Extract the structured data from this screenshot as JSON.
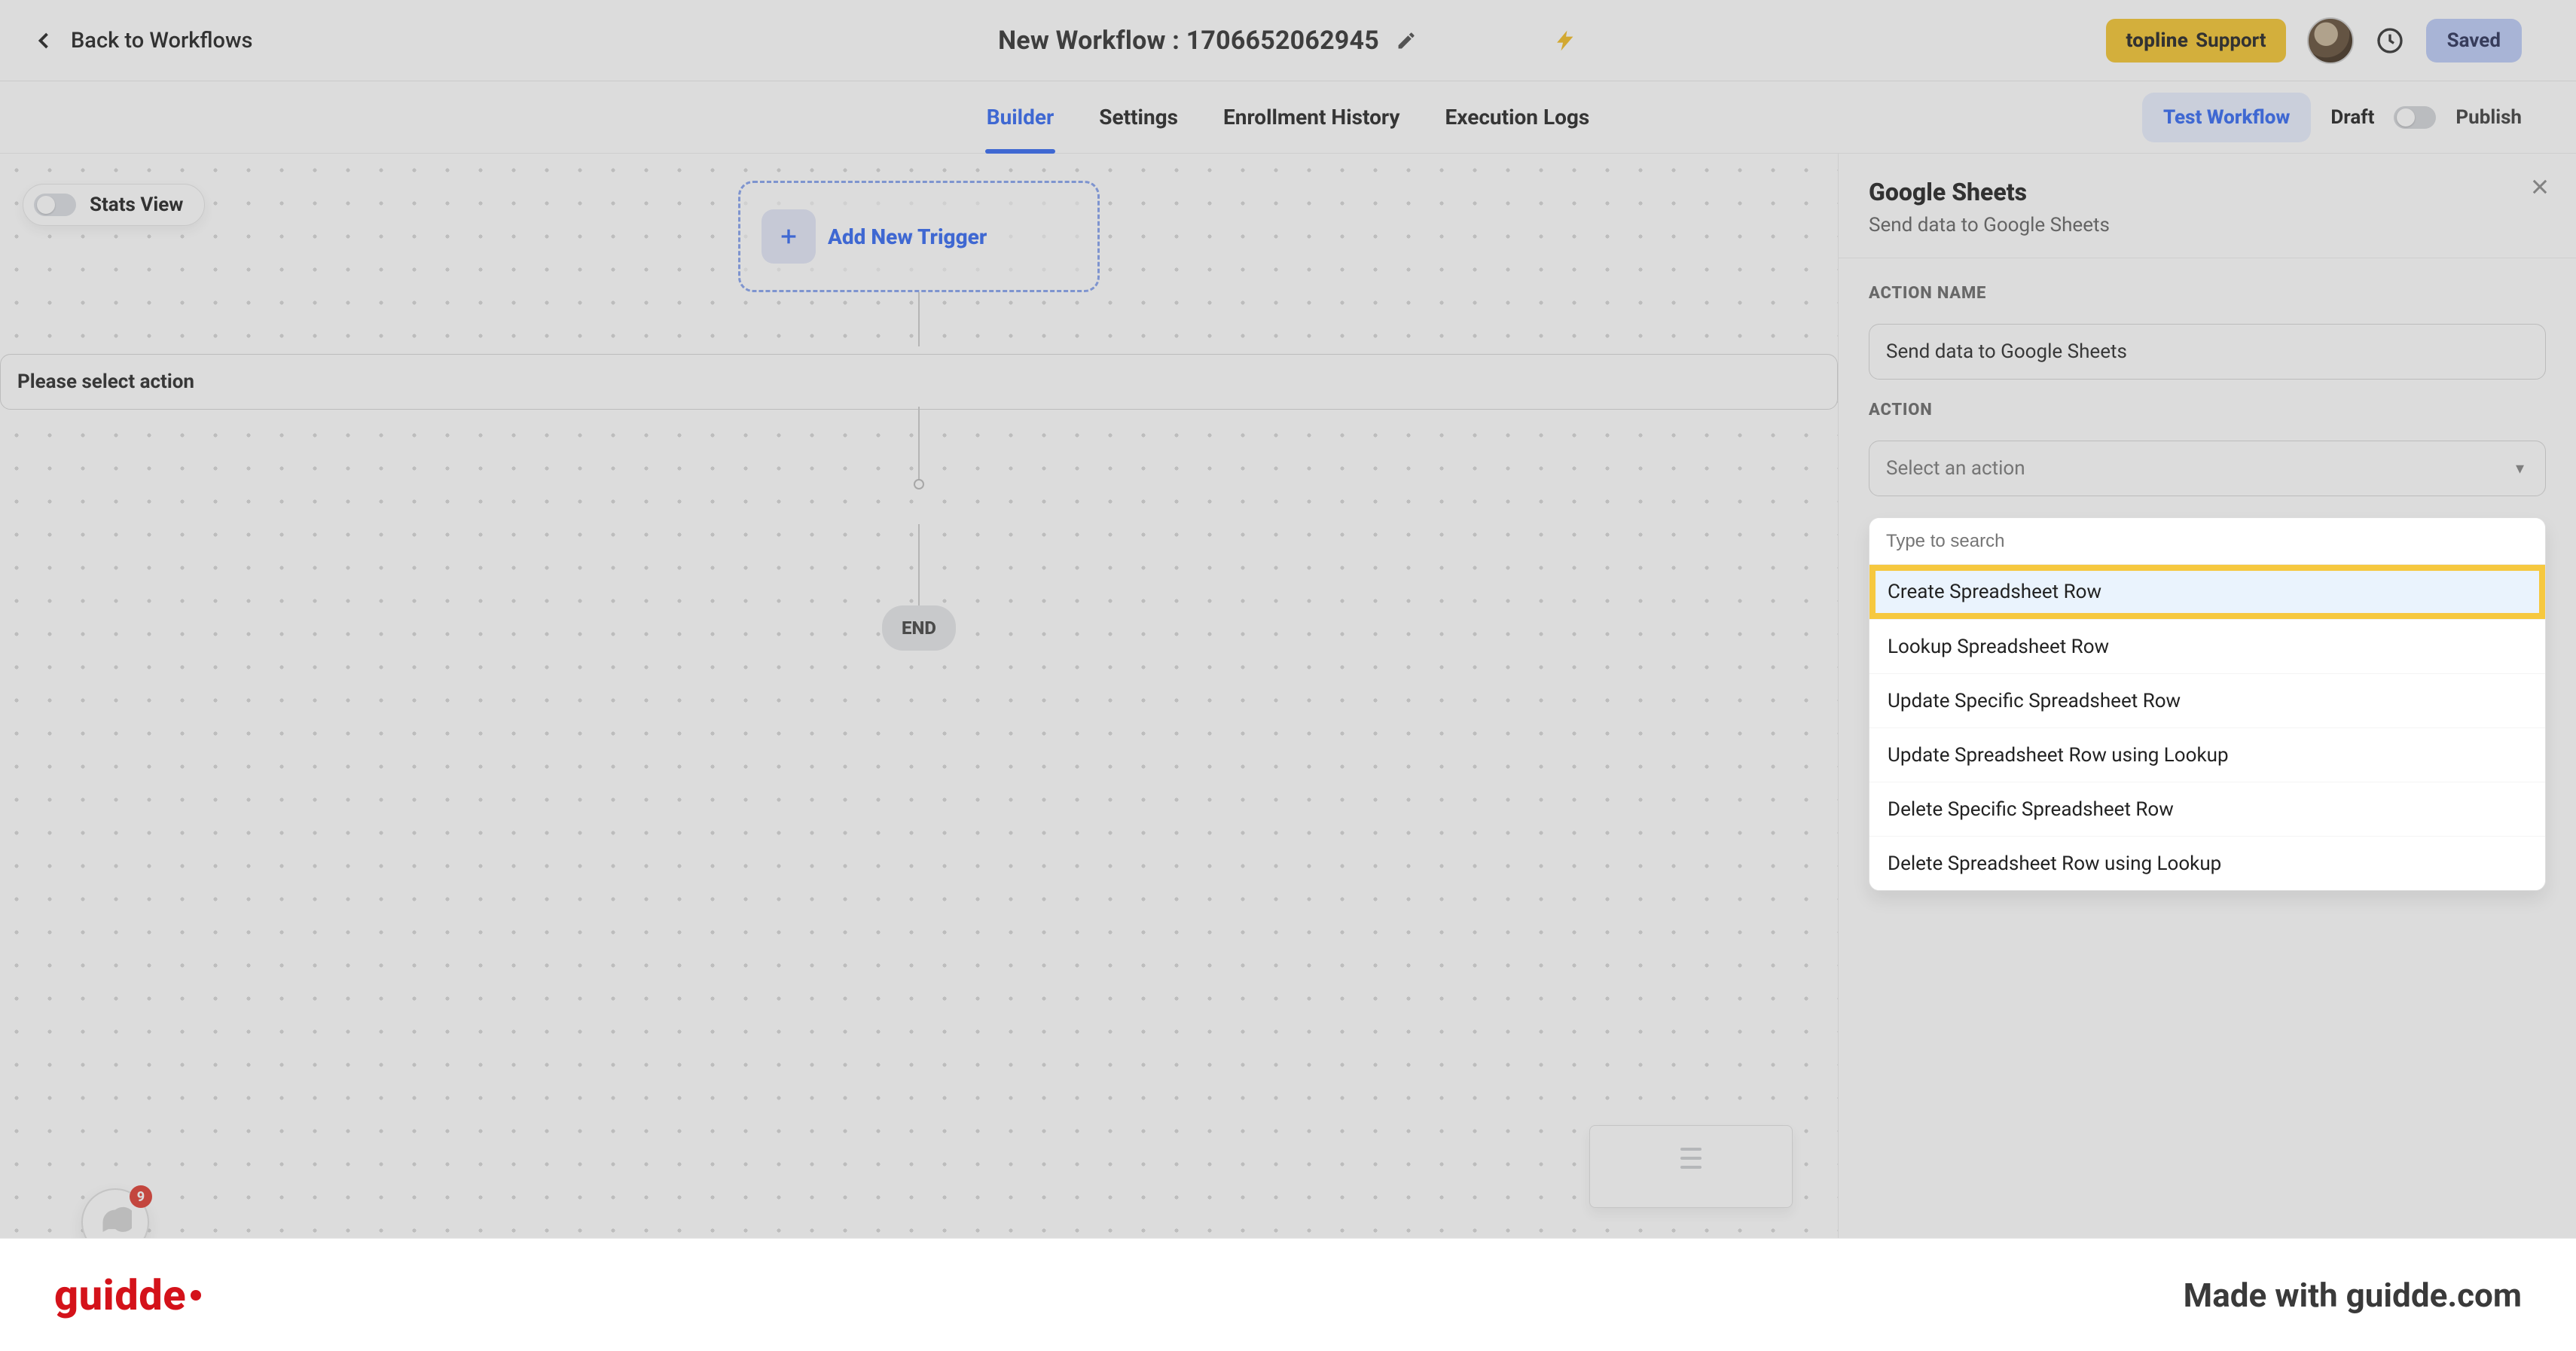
{
  "header": {
    "back_label": "Back to Workflows",
    "title": "New Workflow : 1706652062945",
    "support_brand": "topline",
    "support_label": "Support",
    "saved_label": "Saved"
  },
  "tabs": {
    "builder": "Builder",
    "settings": "Settings",
    "enrollment": "Enrollment History",
    "execution": "Execution Logs",
    "test": "Test Workflow",
    "draft": "Draft",
    "publish": "Publish"
  },
  "canvas": {
    "stats_view": "Stats View",
    "add_trigger": "Add New Trigger",
    "select_action": "Please select action",
    "end": "END",
    "badge_count": "9"
  },
  "panel": {
    "title": "Google Sheets",
    "subtitle": "Send data to Google Sheets",
    "action_name_label": "ACTION NAME",
    "action_name_value": "Send data to Google Sheets",
    "action_label": "ACTION",
    "action_select_placeholder": "Select an action",
    "search_placeholder": "Type to search",
    "options": [
      "Create Spreadsheet Row",
      "Lookup Spreadsheet Row",
      "Update Specific Spreadsheet Row",
      "Update Spreadsheet Row using Lookup",
      "Delete Specific Spreadsheet Row",
      "Delete Spreadsheet Row using Lookup"
    ]
  },
  "footer": {
    "brand": "guidde",
    "made": "Made with guidde.com"
  }
}
